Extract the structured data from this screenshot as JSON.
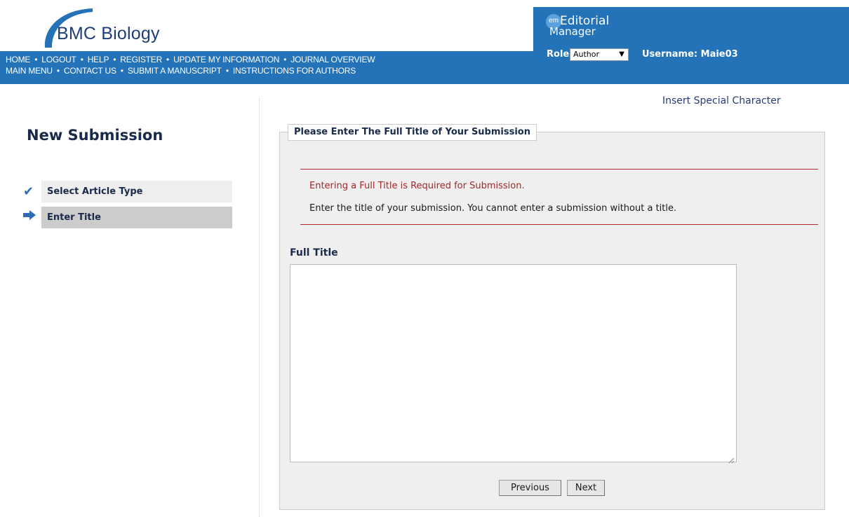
{
  "header": {
    "journal_name": "BMC Biology",
    "nav_row1": [
      "HOME",
      "LOGOUT",
      "HELP",
      "REGISTER",
      "UPDATE MY INFORMATION",
      "JOURNAL OVERVIEW"
    ],
    "nav_row2": [
      "MAIN MENU",
      "CONTACT US",
      "SUBMIT A MANUSCRIPT",
      "INSTRUCTIONS FOR AUTHORS"
    ],
    "nav_separator": "•",
    "em_badge": "em",
    "em_line1": "Editorial",
    "em_line2": "Manager",
    "role_label": "Role:",
    "role_value": "Author",
    "role_arrow": "▼",
    "username": "Username: Maie03",
    "brand_color": "#2472b7"
  },
  "sidebar": {
    "heading": "New Submission",
    "steps": [
      {
        "label": "Select Article Type",
        "icon": "checkmark-icon",
        "state": "complete"
      },
      {
        "label": "Enter Title",
        "icon": "arrow-right-icon",
        "state": "current"
      }
    ]
  },
  "main": {
    "insert_special": "Insert Special Character",
    "legend": "Please Enter The Full Title of Your Submission",
    "error_message": "Entering a Full Title is Required for Submission.",
    "info_message": "Enter the title of your submission. You cannot enter a submission without a title.",
    "field_label": "Full Title",
    "title_value": "",
    "buttons": {
      "previous": "Previous",
      "next": "Next"
    },
    "error_color": "#a5262a"
  }
}
